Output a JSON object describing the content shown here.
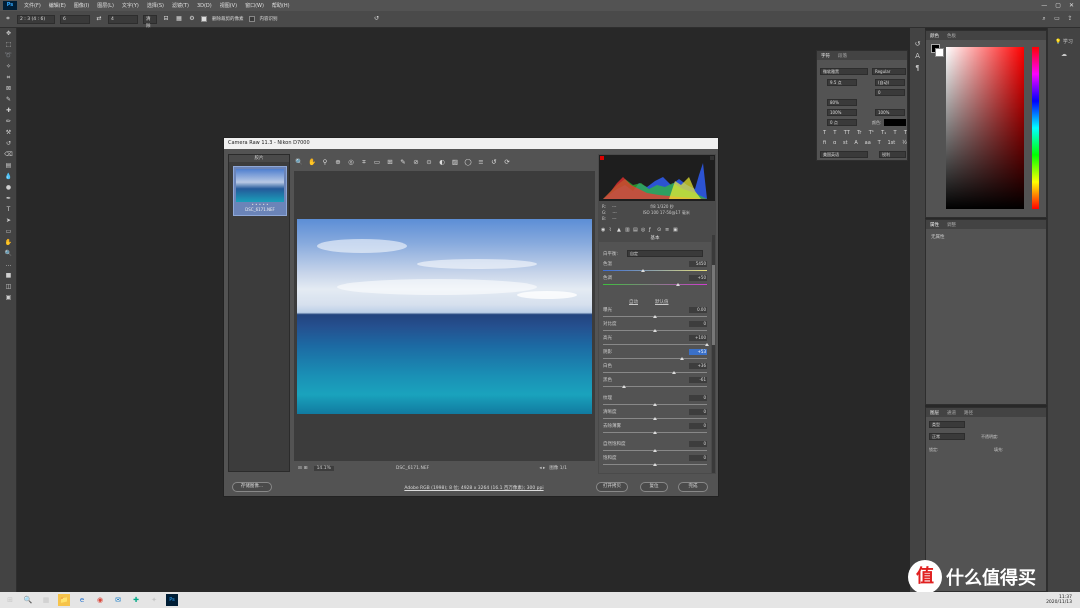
{
  "menubar": {
    "app_icon": "Ps",
    "items": [
      "文件(F)",
      "编辑(E)",
      "图像(I)",
      "图层(L)",
      "文字(Y)",
      "选择(S)",
      "滤镜(T)",
      "3D(D)",
      "视图(V)",
      "窗口(W)",
      "帮助(H)"
    ],
    "window_controls": [
      "—",
      "▢",
      "✕"
    ]
  },
  "optbar": {
    "ratio": "2 : 3 (4 : 6)",
    "width": "6",
    "height": "4",
    "clear": "清除",
    "delete_cropped": "删除裁剪的像素",
    "content_aware": "内容识别"
  },
  "toolbar": {
    "tools": [
      "move-icon",
      "marquee-icon",
      "lasso-icon",
      "magic-wand-icon",
      "crop-icon",
      "frame-icon",
      "eyedropper-icon",
      "healing-icon",
      "brush-icon",
      "stamp-icon",
      "history-brush-icon",
      "eraser-icon",
      "gradient-icon",
      "blur-icon",
      "dodge-icon",
      "pen-icon",
      "type-icon",
      "path-select-icon",
      "shape-icon",
      "hand-icon",
      "zoom-icon",
      "more-icon",
      "colors-icon",
      "quickmask-icon",
      "screenmode-icon"
    ],
    "glyphs": [
      "✥",
      "⬚",
      "➰",
      "✧",
      "⌗",
      "⊠",
      "✎",
      "✚",
      "✏",
      "⚒",
      "↺",
      "⌫",
      "▤",
      "💧",
      "●",
      "✒",
      "T",
      "➤",
      "▭",
      "✋",
      "🔍",
      "…",
      "■",
      "◫",
      "▣"
    ]
  },
  "character_panel": {
    "tabs": [
      "字符",
      "段落"
    ],
    "font": "微软雅黑",
    "style": "Regular",
    "size": "9.5 点",
    "leading": "(自动)",
    "tracking": "0",
    "scale_v": "100%",
    "scale_h": "100%",
    "baseline": "0 点",
    "color_label": "颜色:",
    "vertical_pct": "80%",
    "language": "美国英语",
    "aa": "锐利",
    "type_buttons": [
      "T",
      "T",
      "TT",
      "Tr",
      "T¹",
      "T₁",
      "T",
      "T"
    ],
    "fi_buttons": [
      "fi",
      "ɑ",
      "st",
      "A",
      "aa",
      "T",
      "1st",
      "½"
    ]
  },
  "color_panel": {
    "tabs": [
      "颜色",
      "色板"
    ]
  },
  "right_strip2": {
    "learn": "学习"
  },
  "properties_panel": {
    "tabs": [
      "属性",
      "调整"
    ],
    "content": "无属性"
  },
  "layers_panel": {
    "tabs": [
      "图层",
      "通道",
      "路径"
    ],
    "kind": "类型",
    "blend": "正常",
    "opacity_label": "不透明度:",
    "lock_label": "锁定:",
    "fill_label": "填充:"
  },
  "camera_raw": {
    "title": "Camera Raw 11.3  -  Nikon D7000",
    "filmstrip_title": "胶片",
    "thumb_stars": "• • • • •",
    "thumb_name": "DSC_6171.NEF",
    "toolbar": [
      "🔍",
      "✋",
      "⚲",
      "⊕",
      "◎",
      "⌗",
      "▭",
      "⊞",
      "✎",
      "⊘",
      "⊙",
      "◐",
      "▨",
      "◯",
      "≡",
      "↺",
      "⟳"
    ],
    "zoom": "14.1%",
    "file_name": "DSC_6171.NEF",
    "image_count": "图像 1/1",
    "meta": {
      "r": "R:",
      "g": "G:",
      "b": "B:",
      "dash": "---",
      "exposure": "f/8   1/320 秒",
      "iso": "ISO 100   17-50@17 毫米"
    },
    "panel_title": "基本",
    "wb_label": "白平衡:",
    "wb_value": "自定",
    "auto": "自动",
    "default": "默认值",
    "sliders": [
      {
        "name": "色温",
        "value": "5450",
        "pos": 0.38,
        "hl": false
      },
      {
        "name": "色调",
        "value": "+50",
        "pos": 0.72,
        "hl": false
      },
      {
        "name": "曝光",
        "value": "0.00",
        "pos": 0.5,
        "hl": false
      },
      {
        "name": "对比度",
        "value": "0",
        "pos": 0.5,
        "hl": false
      },
      {
        "name": "高光",
        "value": "+100",
        "pos": 1.0,
        "hl": false
      },
      {
        "name": "阴影",
        "value": "+53",
        "pos": 0.76,
        "hl": true
      },
      {
        "name": "白色",
        "value": "+36",
        "pos": 0.68,
        "hl": false
      },
      {
        "name": "黑色",
        "value": "-61",
        "pos": 0.2,
        "hl": false
      },
      {
        "name": "纹理",
        "value": "0",
        "pos": 0.5,
        "hl": false
      },
      {
        "name": "清晰度",
        "value": "0",
        "pos": 0.5,
        "hl": false
      },
      {
        "name": "去除薄雾",
        "value": "0",
        "pos": 0.5,
        "hl": false
      },
      {
        "name": "自然饱和度",
        "value": "0",
        "pos": 0.5,
        "hl": false
      },
      {
        "name": "饱和度",
        "value": "0",
        "pos": 0.5,
        "hl": false
      }
    ],
    "save_button": "存储图像...",
    "info_link": "Adobe RGB (1998); 8 位; 4928 x 3264 (16.1 百万像素); 300 ppi",
    "open_button": "打开拷贝",
    "reset_button": "复位",
    "done_button": "完成"
  },
  "taskbar": {
    "icons": [
      "⊞",
      "🔍",
      "▦",
      "📁",
      "e",
      "◉",
      "✉",
      "✚",
      "✦",
      "Ps"
    ],
    "time": "11:37",
    "date": "2020/11/13"
  },
  "watermark": {
    "logo": "值",
    "text": "什么值得买"
  },
  "colors": {
    "accent": "#31a8ff",
    "highlight": "#3a70c8"
  }
}
